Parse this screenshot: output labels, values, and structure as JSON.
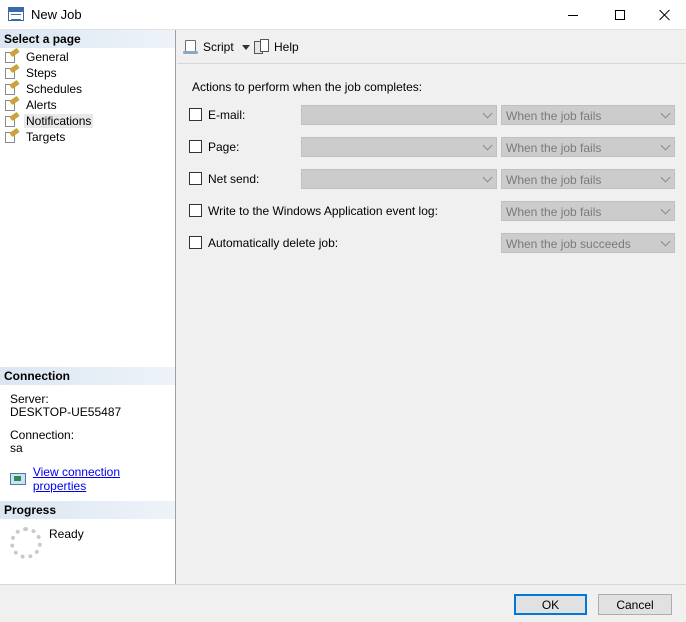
{
  "window": {
    "title": "New Job"
  },
  "left_panel": {
    "select_page_header": "Select a page",
    "pages": [
      {
        "label": "General"
      },
      {
        "label": "Steps"
      },
      {
        "label": "Schedules"
      },
      {
        "label": "Alerts"
      },
      {
        "label": "Notifications",
        "selected": true
      },
      {
        "label": "Targets"
      }
    ],
    "connection": {
      "header": "Connection",
      "server_label": "Server:",
      "server_value": "DESKTOP-UE55487",
      "connection_label": "Connection:",
      "connection_value": "sa",
      "view_properties_link": "View connection properties"
    },
    "progress": {
      "header": "Progress",
      "status": "Ready"
    }
  },
  "toolbar": {
    "script_label": "Script",
    "help_label": "Help"
  },
  "notifications": {
    "heading": "Actions to perform when the job completes:",
    "rows": [
      {
        "label": "E-mail:",
        "checked": false,
        "operator_value": "",
        "when_value": "When the job fails"
      },
      {
        "label": "Page:",
        "checked": false,
        "operator_value": "",
        "when_value": "When the job fails"
      },
      {
        "label": "Net send:",
        "checked": false,
        "operator_value": "",
        "when_value": "When the job fails"
      },
      {
        "label": "Write to the Windows Application event log:",
        "checked": false,
        "when_value": "When the job fails"
      },
      {
        "label": "Automatically delete job:",
        "checked": false,
        "when_value": "When the job succeeds"
      }
    ]
  },
  "footer": {
    "ok_label": "OK",
    "cancel_label": "Cancel"
  },
  "colors": {
    "accent_focus": "#0078d7",
    "section_header": "#dbe6f2",
    "disabled_combo": "#cccccc",
    "link": "#0000ee"
  }
}
